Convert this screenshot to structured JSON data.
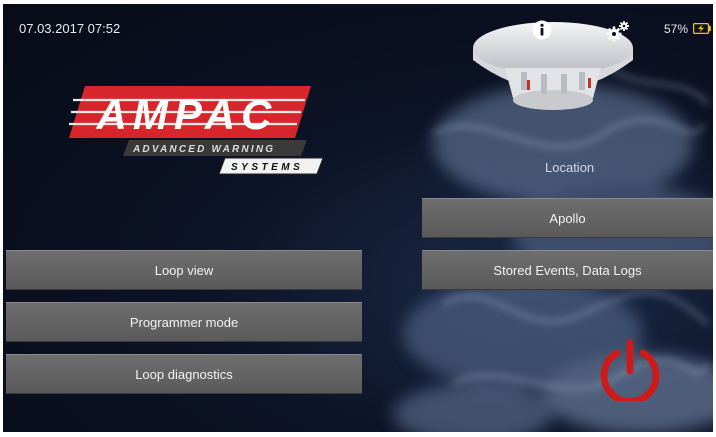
{
  "status_bar": {
    "datetime": "07.03.2017 07:52",
    "battery_percent_label": "57%",
    "icons": {
      "info": "info-icon",
      "settings": "gears-icon",
      "battery": "battery-charging-icon"
    }
  },
  "logo": {
    "brand": "AMPAC",
    "tagline_1": "ADVANCED WARNING",
    "tagline_2": "SYSTEMS"
  },
  "right_panel": {
    "location_label": "Location",
    "buttons": [
      {
        "label": "Apollo"
      },
      {
        "label": "Stored Events, Data Logs"
      }
    ]
  },
  "left_menu": {
    "buttons": [
      {
        "label": "Loop view"
      },
      {
        "label": "Programmer mode"
      },
      {
        "label": "Loop diagnostics"
      }
    ]
  },
  "power": {
    "icon": "power-icon"
  },
  "colors": {
    "brand_red": "#d7262b",
    "button_gray": "#646464",
    "power_red": "#cc1b1b",
    "background": "#0a1020"
  }
}
